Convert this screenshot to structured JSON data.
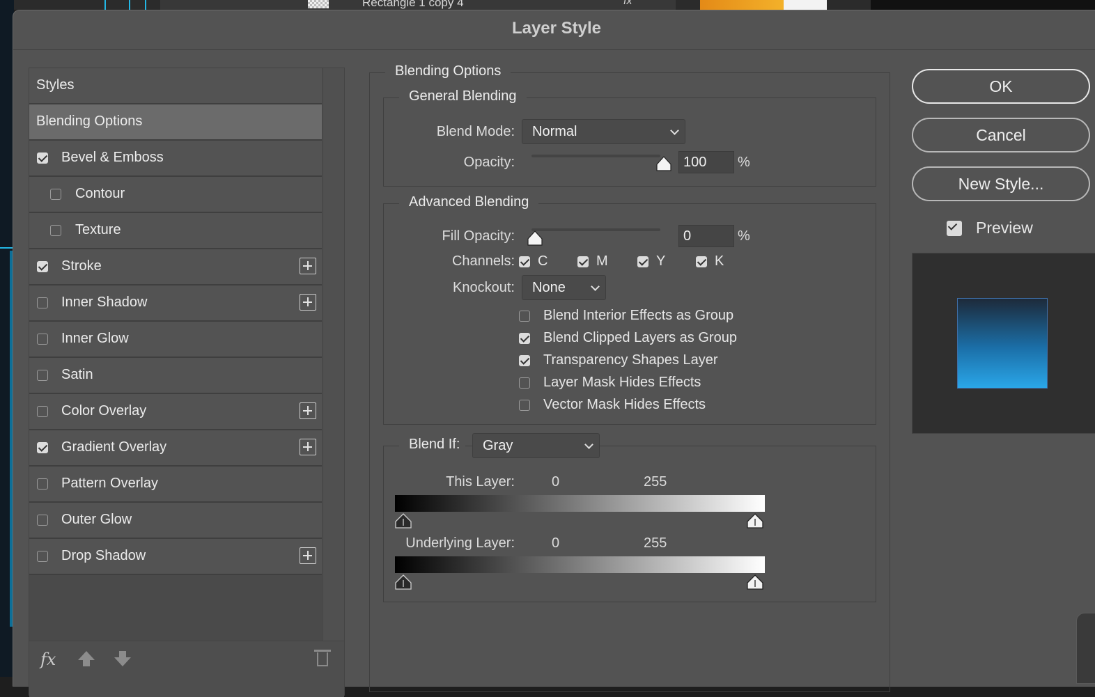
{
  "background": {
    "layer_name": "Rectangle 1 copy 4",
    "fx_label": "fx"
  },
  "dialog": {
    "title": "Layer Style"
  },
  "style_list": {
    "items": [
      {
        "label": "Styles",
        "checkbox": false,
        "checked": false,
        "plus": false,
        "selected": false
      },
      {
        "label": "Blending Options",
        "checkbox": false,
        "checked": false,
        "plus": false,
        "selected": true
      },
      {
        "label": "Bevel & Emboss",
        "checkbox": true,
        "checked": true,
        "plus": false,
        "selected": false
      },
      {
        "label": "Contour",
        "checkbox": true,
        "checked": false,
        "plus": false,
        "selected": false,
        "indent": true
      },
      {
        "label": "Texture",
        "checkbox": true,
        "checked": false,
        "plus": false,
        "selected": false,
        "indent": true
      },
      {
        "label": "Stroke",
        "checkbox": true,
        "checked": true,
        "plus": true,
        "selected": false
      },
      {
        "label": "Inner Shadow",
        "checkbox": true,
        "checked": false,
        "plus": true,
        "selected": false
      },
      {
        "label": "Inner Glow",
        "checkbox": true,
        "checked": false,
        "plus": false,
        "selected": false
      },
      {
        "label": "Satin",
        "checkbox": true,
        "checked": false,
        "plus": false,
        "selected": false
      },
      {
        "label": "Color Overlay",
        "checkbox": true,
        "checked": false,
        "plus": true,
        "selected": false
      },
      {
        "label": "Gradient Overlay",
        "checkbox": true,
        "checked": true,
        "plus": true,
        "selected": false
      },
      {
        "label": "Pattern Overlay",
        "checkbox": true,
        "checked": false,
        "plus": false,
        "selected": false
      },
      {
        "label": "Outer Glow",
        "checkbox": true,
        "checked": false,
        "plus": false,
        "selected": false
      },
      {
        "label": "Drop Shadow",
        "checkbox": true,
        "checked": false,
        "plus": true,
        "selected": false
      }
    ],
    "footer_fx": "fx"
  },
  "blending": {
    "section_title": "Blending Options",
    "general": {
      "title": "General Blending",
      "blend_mode_label": "Blend Mode:",
      "blend_mode_value": "Normal",
      "opacity_label": "Opacity:",
      "opacity_value": "100",
      "opacity_fraction": 1.0,
      "percent": "%"
    },
    "advanced": {
      "title": "Advanced Blending",
      "fill_opacity_label": "Fill Opacity:",
      "fill_opacity_value": "0",
      "fill_opacity_fraction": 0.0,
      "percent": "%",
      "channels_label": "Channels:",
      "channels": [
        {
          "label": "C",
          "checked": true
        },
        {
          "label": "M",
          "checked": true
        },
        {
          "label": "Y",
          "checked": true
        },
        {
          "label": "K",
          "checked": true
        }
      ],
      "knockout_label": "Knockout:",
      "knockout_value": "None",
      "options": [
        {
          "label": "Blend Interior Effects as Group",
          "checked": false
        },
        {
          "label": "Blend Clipped Layers as Group",
          "checked": true
        },
        {
          "label": "Transparency Shapes Layer",
          "checked": true
        },
        {
          "label": "Layer Mask Hides Effects",
          "checked": false
        },
        {
          "label": "Vector Mask Hides Effects",
          "checked": false
        }
      ]
    },
    "blend_if": {
      "label": "Blend If:",
      "value": "Gray",
      "this_layer_label": "This Layer:",
      "this_layer_low": "0",
      "this_layer_high": "255",
      "underlying_label": "Underlying Layer:",
      "underlying_low": "0",
      "underlying_high": "255"
    }
  },
  "buttons": {
    "ok": "OK",
    "cancel": "Cancel",
    "new_style": "New Style...",
    "preview_label": "Preview",
    "preview_checked": true
  },
  "colors": {
    "dialog_bg": "#535353",
    "selected_row": "#6b6b6b",
    "preview_gradient_top": "#1d2a3a",
    "preview_gradient_bottom": "#2aa6e8"
  }
}
